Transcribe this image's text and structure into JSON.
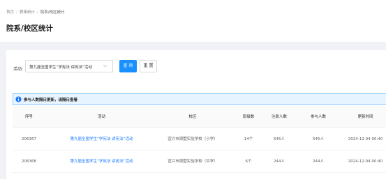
{
  "breadcrumb": {
    "items": [
      "首页",
      "赛事统计",
      "院系/校区统计"
    ]
  },
  "page": {
    "title": "院系/校区统计"
  },
  "filter": {
    "activity_label": "活动:",
    "activity_value": "第九届全国学生“学宪法 讲宪法”活动",
    "query_label": "查 询",
    "reset_label": "重 置"
  },
  "alert": {
    "text": "参与人数隔日更新，请隔日查看",
    "color": "#1677ff"
  },
  "table": {
    "headers": [
      "序号",
      "活动",
      "校区",
      "班级数",
      "注册人数",
      "参与人数",
      "更新时间"
    ],
    "rows": [
      [
        "206367",
        "第九届全国学生“学宪法 讲宪法”活动",
        "宜兴市周墅实验学校（小学）",
        "14个",
        "545人",
        "545人",
        "2024-12-04 00:40"
      ],
      [
        "206368",
        "第九届全国学生“学宪法 讲宪法”活动",
        "宜兴市周墅实验学校（中学）",
        "6个",
        "244人",
        "244人",
        "2024-12-04 00:40"
      ]
    ]
  },
  "colors": {
    "primary": "#1890ff",
    "link": "#1677ff",
    "alert_bg": "#e6f4ff"
  },
  "icons": {
    "select_arrow": "chevron-down-icon",
    "alert": "info-circle-icon"
  }
}
